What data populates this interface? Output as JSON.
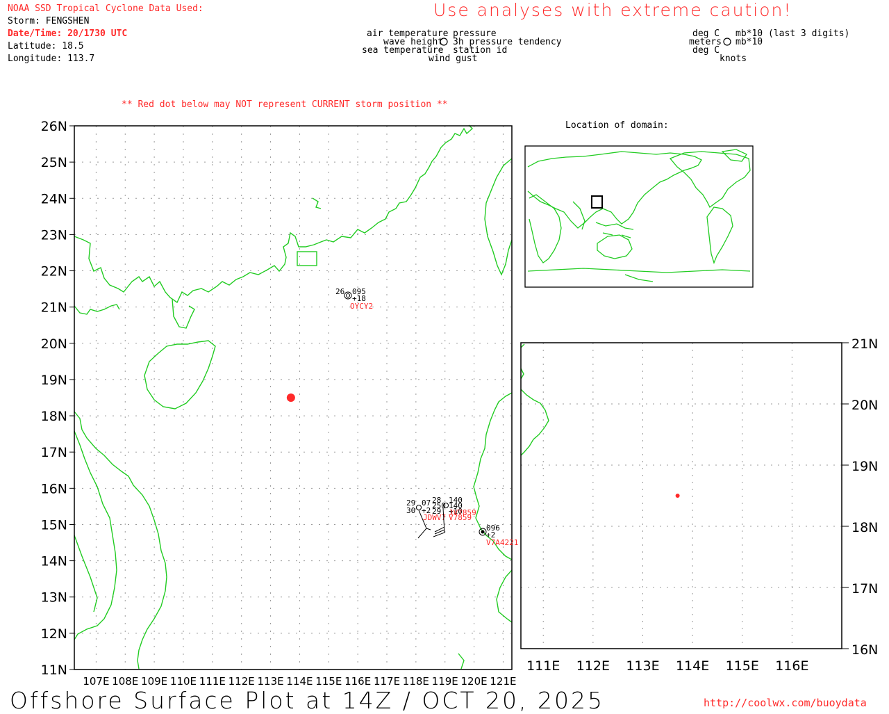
{
  "header": {
    "source_line": "NOAA SSD Tropical Cyclone Data Used:",
    "storm_line": "Storm: FENGSHEN",
    "datetime_line": "Date/Time: 20/1730 UTC",
    "lat_line": "Latitude: 18.5",
    "lon_line": "Longitude: 113.7",
    "caution": "Use analyses with extreme caution!"
  },
  "legend": {
    "air_temperature": "air temperature",
    "pressure": "pressure",
    "wave_height": "wave height",
    "pressure_tendency": "3h pressure tendency",
    "sea_temperature": "sea temperature",
    "station_id": "station id",
    "wind_gust": "wind gust",
    "unit_air": "deg C",
    "unit_pressure": "mb*10 (last 3 digits)",
    "unit_wave": "meters",
    "unit_tendency": "mb*10",
    "unit_sea": "deg C",
    "unit_gust": "knots"
  },
  "notice": "** Red dot below may NOT represent CURRENT storm position **",
  "main_map": {
    "lat_labels": [
      "26N",
      "25N",
      "24N",
      "23N",
      "22N",
      "21N",
      "20N",
      "19N",
      "18N",
      "17N",
      "16N",
      "15N",
      "14N",
      "13N",
      "12N",
      "11N"
    ],
    "lon_labels": [
      "107E",
      "108E",
      "109E",
      "110E",
      "111E",
      "112E",
      "113E",
      "114E",
      "115E",
      "116E",
      "117E",
      "118E",
      "119E",
      "120E",
      "121E"
    ],
    "storm_position": {
      "lat": 18.5,
      "lon": 113.7
    },
    "stations": [
      {
        "id": "OYCY2",
        "air_temp": "26",
        "pressure": "095",
        "tendency": "+18"
      },
      {
        "id": "JDWV7",
        "air_temp": "29",
        "pressure": "07",
        "tendency": "+2"
      },
      {
        "id": "V7859",
        "air_temp": "28",
        "pressure": "140",
        "tendency": "+10"
      },
      {
        "id": "V7A4221",
        "air_temp": "",
        "pressure": "096",
        "tendency": "+2"
      }
    ],
    "station_extra_text": [
      "30",
      "250",
      "29",
      "140",
      "+10",
      "JV7859"
    ]
  },
  "inset": {
    "title": "Location of domain:"
  },
  "zoom_map": {
    "lat_labels": [
      "21N",
      "20N",
      "19N",
      "18N",
      "17N",
      "16N"
    ],
    "lon_labels": [
      "111E",
      "112E",
      "113E",
      "114E",
      "115E",
      "116E"
    ]
  },
  "footer": {
    "title": "Offshore Surface Plot at 14Z / OCT 20, 2025",
    "url": "http://coolwx.com/buoydata"
  },
  "colors": {
    "coast": "#22cc22",
    "accent": "#ff2a2a",
    "grid": "#aaaaaa"
  }
}
